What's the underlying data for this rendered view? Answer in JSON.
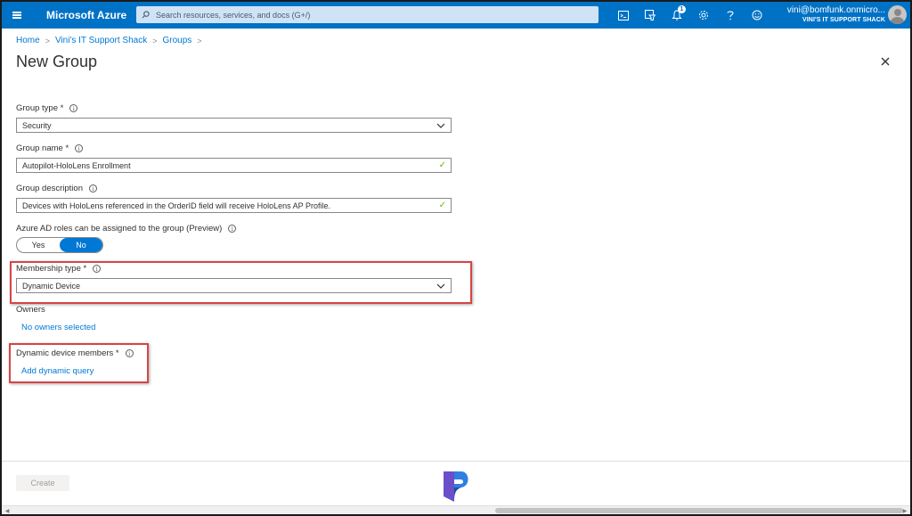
{
  "topbar": {
    "brand": "Microsoft Azure",
    "search_placeholder": "Search resources, services, and docs (G+/)",
    "notification_count": "1",
    "account_email": "vini@bomfunk.onmicro...",
    "account_tenant": "VINI'S IT SUPPORT SHACK",
    "icons": [
      "menu-icon",
      "cloud-shell-icon",
      "directory-filter-icon",
      "notifications-icon",
      "settings-icon",
      "help-icon",
      "feedback-icon"
    ]
  },
  "breadcrumb": {
    "items": [
      "Home",
      "Vini's IT Support Shack",
      "Groups"
    ],
    "separator": ">"
  },
  "page": {
    "title": "New Group"
  },
  "form": {
    "group_type": {
      "label": "Group type *",
      "value": "Security"
    },
    "group_name": {
      "label": "Group name *",
      "value": "Autopilot-HoloLens Enrollment"
    },
    "group_description": {
      "label": "Group description",
      "value": "Devices with HoloLens referenced in the OrderID field will receive HoloLens AP Profile."
    },
    "azure_ad_roles": {
      "label": "Azure AD roles can be assigned to the group (Preview)",
      "yes": "Yes",
      "no": "No",
      "selected": "No"
    },
    "membership_type": {
      "label": "Membership type *",
      "value": "Dynamic Device"
    },
    "owners": {
      "label": "Owners",
      "link": "No owners selected"
    },
    "dynamic_members": {
      "label": "Dynamic device members *",
      "link": "Add dynamic query"
    }
  },
  "footer": {
    "create_label": "Create"
  },
  "colors": {
    "azure_blue": "#0072c6",
    "link_blue": "#0078d4",
    "highlight_red": "#d64545",
    "check_green": "#6bb700"
  }
}
